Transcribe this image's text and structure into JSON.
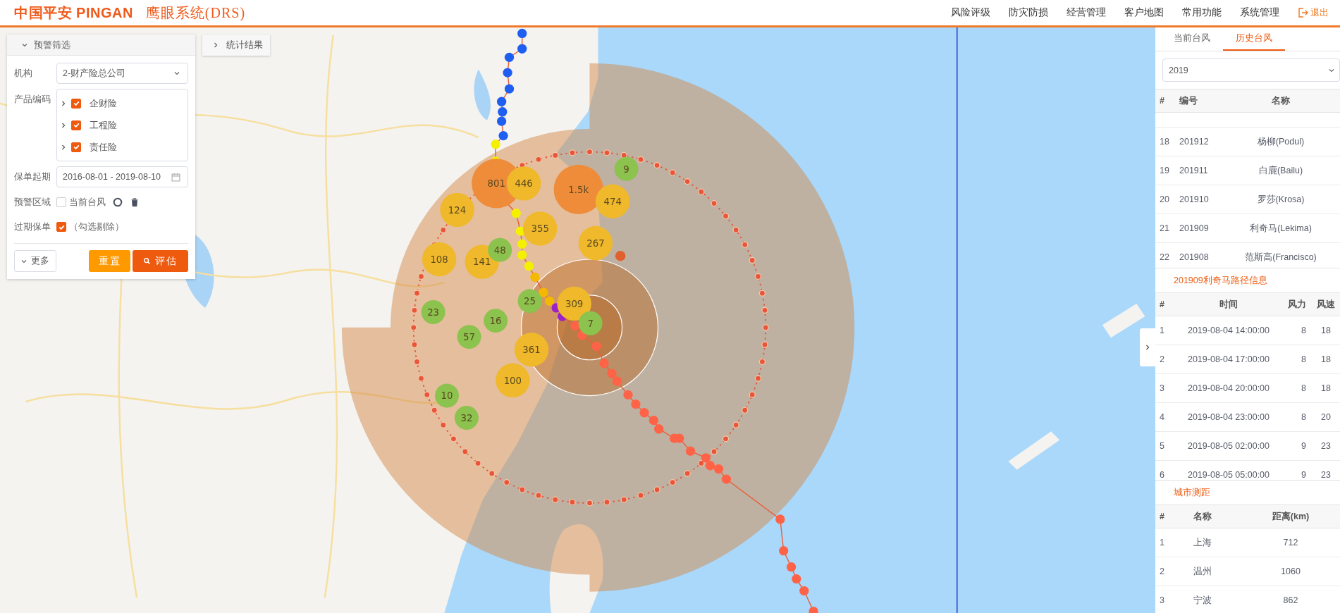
{
  "header": {
    "logo": "中国平安 PINGAN",
    "app_title": "鹰眼系统(DRS)",
    "nav": [
      "风险评级",
      "防灾防损",
      "经营管理",
      "客户地图",
      "常用功能",
      "系统管理"
    ],
    "logout": "退出"
  },
  "filter_panel": {
    "title": "预警筛选",
    "expanded": true,
    "org_label": "机构",
    "org_value": "2-财产险总公司",
    "product_label": "产品编码",
    "products": [
      {
        "label": "企财险",
        "checked": true
      },
      {
        "label": "工程险",
        "checked": true
      },
      {
        "label": "责任险",
        "checked": true
      }
    ],
    "date_label": "保单起期",
    "date_value": "2016-08-01 - 2019-08-10",
    "area_label": "预警区域",
    "area_option": {
      "label": "当前台风",
      "checked": false
    },
    "expired_label": "过期保单",
    "expired_option": {
      "label": "（勾选剔除）",
      "checked": true
    },
    "more": "更多",
    "reset": "重置",
    "evaluate": "评估"
  },
  "stats_tab": {
    "label": "统计结果"
  },
  "clusters": [
    {
      "label": "801",
      "color": "#ef8c3a"
    },
    {
      "label": "446",
      "color": "#f0b92c"
    },
    {
      "label": "1.5k",
      "color": "#ef8c3a"
    },
    {
      "label": "9",
      "color": "#8cc24e"
    },
    {
      "label": "474",
      "color": "#f0b92c"
    },
    {
      "label": "124",
      "color": "#f0b92c"
    },
    {
      "label": "355",
      "color": "#f0b92c"
    },
    {
      "label": "267",
      "color": "#f0b92c"
    },
    {
      "label": "108",
      "color": "#f0b92c"
    },
    {
      "label": "141",
      "color": "#f0b92c"
    },
    {
      "label": "48",
      "color": "#8cc24e"
    },
    {
      "label": "25",
      "color": "#8cc24e"
    },
    {
      "label": "309",
      "color": "#f0b92c"
    },
    {
      "label": "23",
      "color": "#8cc24e"
    },
    {
      "label": "16",
      "color": "#8cc24e"
    },
    {
      "label": "57",
      "color": "#8cc24e"
    },
    {
      "label": "7",
      "color": "#8cc24e"
    },
    {
      "label": "361",
      "color": "#f0b92c"
    },
    {
      "label": "100",
      "color": "#f0b92c"
    },
    {
      "label": "10",
      "color": "#8cc24e"
    },
    {
      "label": "32",
      "color": "#8cc24e"
    }
  ],
  "right_panel": {
    "tabs": [
      {
        "label": "当前台风",
        "selected": false
      },
      {
        "label": "历史台风",
        "selected": true
      }
    ],
    "year": "2019",
    "typhoon_table": {
      "columns": [
        "#",
        "编号",
        "名称"
      ],
      "rows": [
        [
          "18",
          "201912",
          "杨柳(Podul)"
        ],
        [
          "19",
          "201911",
          "白鹿(Bailu)"
        ],
        [
          "20",
          "201910",
          "罗莎(Krosa)"
        ],
        [
          "21",
          "201909",
          "利奇马(Lekima)"
        ],
        [
          "22",
          "201908",
          "范斯高(Francisco)"
        ]
      ]
    },
    "path_title": "201909利奇马路径信息",
    "path_table": {
      "columns": [
        "#",
        "时间",
        "风力",
        "风速"
      ],
      "rows": [
        [
          "1",
          "2019-08-04 14:00:00",
          "8",
          "18"
        ],
        [
          "2",
          "2019-08-04 17:00:00",
          "8",
          "18"
        ],
        [
          "3",
          "2019-08-04 20:00:00",
          "8",
          "18"
        ],
        [
          "4",
          "2019-08-04 23:00:00",
          "8",
          "20"
        ],
        [
          "5",
          "2019-08-05 02:00:00",
          "9",
          "23"
        ],
        [
          "6",
          "2019-08-05 05:00:00",
          "9",
          "23"
        ]
      ]
    },
    "city_title": "城市测距",
    "city_table": {
      "columns": [
        "#",
        "名称",
        "距离(km)"
      ],
      "rows": [
        [
          "1",
          "上海",
          "712"
        ],
        [
          "2",
          "温州",
          "1060"
        ],
        [
          "3",
          "宁波",
          "862"
        ]
      ]
    }
  }
}
